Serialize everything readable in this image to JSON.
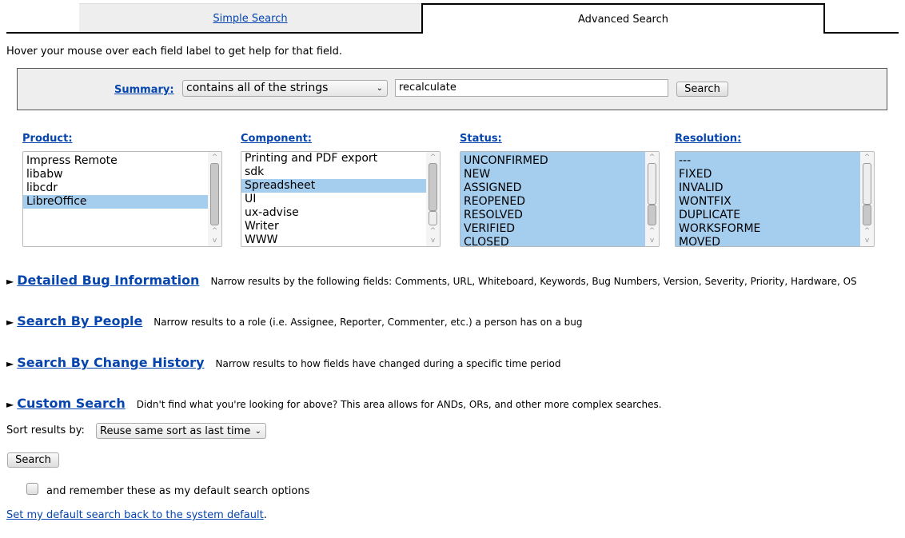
{
  "tabs": {
    "simple": "Simple Search",
    "advanced": "Advanced Search"
  },
  "help_text": "Hover your mouse over each field label to get help for that field.",
  "summary": {
    "label": "Summary:",
    "operator": "contains all of the strings",
    "value": "recalculate",
    "search_label": "Search"
  },
  "fields": {
    "product": {
      "label": "Product:",
      "options": [
        "Impress Remote",
        "libabw",
        "libcdr",
        "LibreOffice"
      ],
      "selected": [
        "LibreOffice"
      ]
    },
    "component": {
      "label": "Component:",
      "options": [
        "Printing and PDF export",
        "sdk",
        "Spreadsheet",
        "UI",
        "ux-advise",
        "Writer",
        "WWW"
      ],
      "selected": [
        "Spreadsheet"
      ]
    },
    "status": {
      "label": "Status:",
      "options": [
        "UNCONFIRMED",
        "NEW",
        "ASSIGNED",
        "REOPENED",
        "RESOLVED",
        "VERIFIED",
        "CLOSED"
      ],
      "selected": "all"
    },
    "resolution": {
      "label": "Resolution:",
      "options": [
        "---",
        "FIXED",
        "INVALID",
        "WONTFIX",
        "DUPLICATE",
        "WORKSFORME",
        "MOVED"
      ],
      "selected": "all"
    }
  },
  "sections": [
    {
      "title": "Detailed Bug Information",
      "desc": "Narrow results by the following fields: Comments, URL, Whiteboard, Keywords, Bug Numbers, Version, Severity, Priority, Hardware, OS"
    },
    {
      "title": "Search By People",
      "desc": "Narrow results to a role (i.e. Assignee, Reporter, Commenter, etc.) a person has on a bug"
    },
    {
      "title": "Search By Change History",
      "desc": "Narrow results to how fields have changed during a specific time period"
    },
    {
      "title": "Custom Search",
      "desc": "Didn't find what you're looking for above? This area allows for ANDs, ORs, and other more complex searches."
    }
  ],
  "sort": {
    "label": "Sort results by:",
    "value": "Reuse same sort as last time"
  },
  "search_button": "Search",
  "remember_label": "and remember these as my default search options",
  "remember_checked": false,
  "reset_link": "Set my default search back to the system default",
  "reset_suffix": ".",
  "colors": {
    "link": "#0645ad",
    "selection": "#a5cdee",
    "panel": "#eeeeee"
  }
}
